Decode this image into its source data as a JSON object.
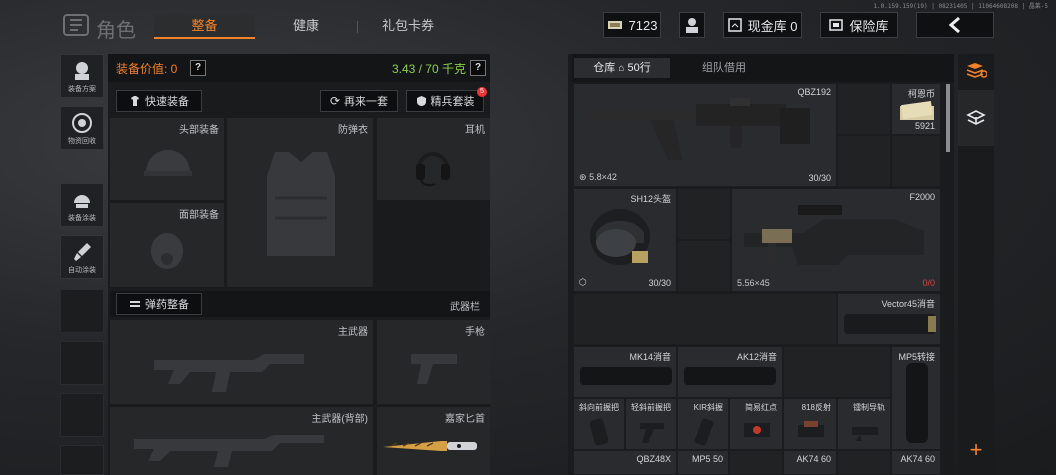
{
  "version": "1.0.159.159(19) | 08231405 | 11064608208 | 晶莱-5",
  "header": {
    "title": "角色",
    "tabs": [
      "整备",
      "健康",
      "礼包卡券"
    ],
    "active_tab": "整备",
    "currency_amount": "7123",
    "cash_vault_label": "现金库 0",
    "insurance_label": "保险库"
  },
  "sidebar": {
    "items": [
      {
        "label": "装备方案",
        "icon": "loadout-icon"
      },
      {
        "label": "物资回收",
        "icon": "recycle-icon"
      },
      {
        "label": "装备涂装",
        "icon": "helmet-paint-icon"
      },
      {
        "label": "自动涂装",
        "icon": "brush-icon"
      }
    ]
  },
  "equipment": {
    "value_label": "装备价值: 0",
    "weight_label": "3.43 / 70 千克",
    "quick_equip": "快速装备",
    "redo_label": "再来一套",
    "elite_label": "精兵套装",
    "elite_badge": "5",
    "slots": {
      "head": "头部装备",
      "armor": "防弹衣",
      "ear": "耳机",
      "face": "面部装备"
    },
    "ammo_button": "弹药整备",
    "weapon_bar": "武器栏",
    "weapon_slots": {
      "primary": "主武器",
      "pistol": "手枪",
      "primary_back": "主武器(背部)",
      "knife": "嘉家匕首"
    }
  },
  "inventory": {
    "tabs": {
      "warehouse": "仓库",
      "warehouse_count": "50行",
      "team": "组队借用"
    },
    "items": {
      "qbz192": {
        "name": "QBZ192",
        "caliber": "5.8×42",
        "count": "30/30"
      },
      "kohn": {
        "name": "柯恩币",
        "count": "5921"
      },
      "sh12": {
        "name": "SH12头盔",
        "count": "30/30"
      },
      "f2000": {
        "name": "F2000",
        "caliber": "5.56×45",
        "count": "0/0"
      },
      "vector": {
        "name": "Vector45消音"
      },
      "mk14": {
        "name": "MK14消音"
      },
      "ak12": {
        "name": "AK12消音"
      },
      "mp5": {
        "name": "MP5转接"
      },
      "row5": [
        "斜向前握把",
        "轻斜前握把",
        "KIR斜握",
        "简易红点",
        "818反射",
        "镭制导轨"
      ],
      "row6": [
        "QBZ48X",
        "MP5 50",
        "AK74 60",
        "AK74 60"
      ]
    }
  },
  "colors": {
    "accent": "#f3812a",
    "weight_ok": "#8bd14a",
    "danger": "#e33333"
  }
}
